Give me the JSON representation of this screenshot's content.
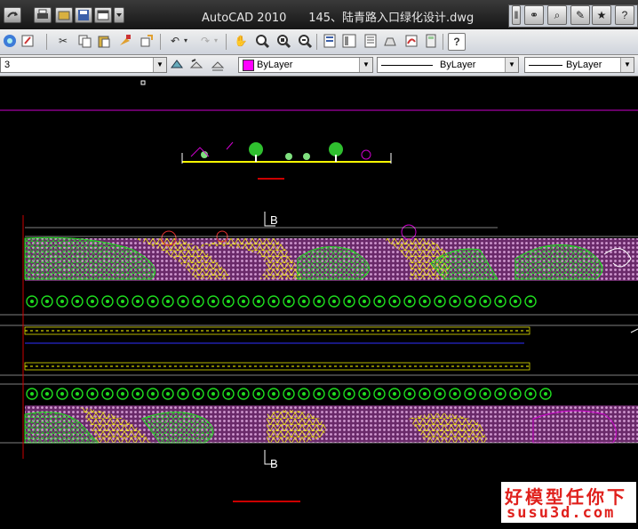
{
  "window": {
    "app_title": "AutoCAD 2010",
    "doc_title": "145、陆青路入口绿化设计.dwg"
  },
  "quick_access": {
    "icons": [
      "redo-icon",
      "print-icon",
      "open-icon",
      "save-icon",
      "workspace-icon",
      "dropdown-icon"
    ]
  },
  "right_toolbar": {
    "icons": [
      "binoculars-icon",
      "search-icon",
      "wrench-icon",
      "satellite-icon",
      "star-icon",
      "help-icon"
    ]
  },
  "toolbar1": {
    "icons": [
      "globe-icon",
      "edit-icon",
      "cut-icon",
      "copy-icon",
      "paste-icon",
      "match-properties-icon",
      "block-icon",
      "undo-icon",
      "redo-icon",
      "pan-icon",
      "zoom-realtime-icon",
      "zoom-window-icon",
      "zoom-previous-icon",
      "properties-icon",
      "design-center-icon",
      "tool-palettes-icon",
      "sheet-set-icon",
      "markup-icon",
      "calculator-icon",
      "help-icon"
    ],
    "help_label": "?"
  },
  "toolbar2": {
    "layer_value": "3",
    "color_value": "ByLayer",
    "color_swatch": "#ff00ff",
    "linetype_value": "ByLayer",
    "lineweight_value": "ByLayer"
  },
  "drawing": {
    "labels": [
      "B",
      "B"
    ],
    "accent_magenta": "#cc00cc",
    "accent_green": "#00e000",
    "accent_yellow": "#ffff00"
  },
  "watermark": {
    "cn": "好模型任你下",
    "en": "susu3d.com"
  }
}
